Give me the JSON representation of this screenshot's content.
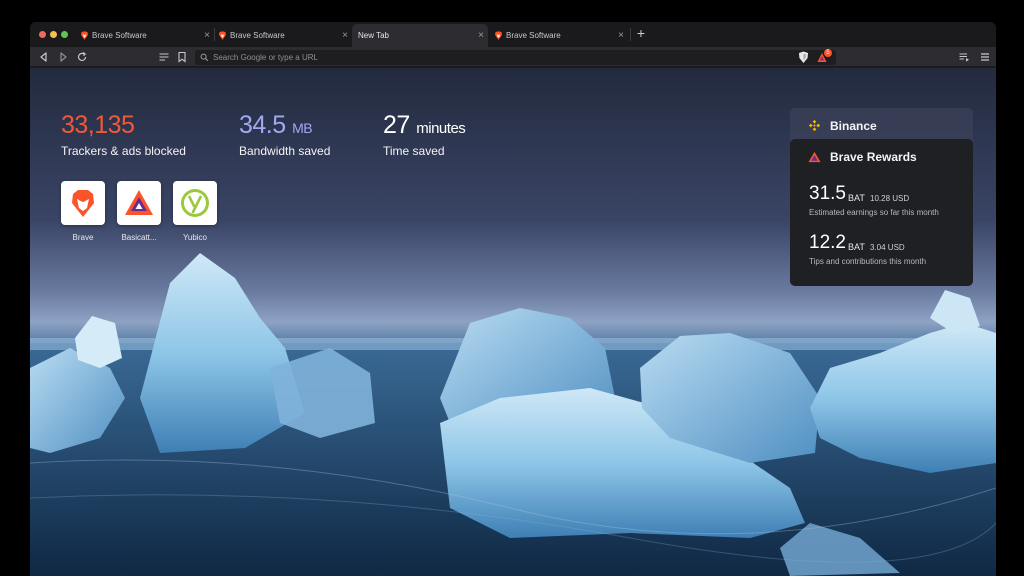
{
  "tabs": [
    {
      "title": "Brave Software",
      "icon": "brave-lion-icon",
      "active": false
    },
    {
      "title": "Brave Software",
      "icon": "brave-lion-icon",
      "active": false
    },
    {
      "title": "New Tab",
      "icon": "",
      "active": true
    },
    {
      "title": "Brave Software",
      "icon": "brave-lion-icon",
      "active": false
    }
  ],
  "tab_close_glyph": "×",
  "new_tab_glyph": "+",
  "toolbar": {
    "omnibox_placeholder": "Search Google or type a URL",
    "rewards_badge_count": "5"
  },
  "stats": {
    "trackers": {
      "value": "33,135",
      "label": "Trackers & ads blocked",
      "color": "#f0583a"
    },
    "bandwidth": {
      "value": "34.5",
      "unit": "MB",
      "label": "Bandwidth saved",
      "color": "#a4a7f2"
    },
    "time": {
      "value": "27",
      "unit": "minutes",
      "label": "Time saved",
      "color": "#ffffff"
    }
  },
  "top_sites": [
    {
      "name": "Brave",
      "icon": "brave-lion-icon"
    },
    {
      "name": "Basicatt...",
      "icon": "bat-triangle-icon"
    },
    {
      "name": "Yubico",
      "icon": "yubico-icon"
    }
  ],
  "binance": {
    "title": "Binance",
    "icon": "binance-icon",
    "color": "#f0b90b"
  },
  "rewards": {
    "title": "Brave Rewards",
    "icon": "bat-triangle-icon",
    "earnings": {
      "amount": "31.5",
      "unit": "BAT",
      "usd": "10.28 USD",
      "caption": "Estimated earnings so far this month"
    },
    "tips": {
      "amount": "12.2",
      "unit": "BAT",
      "usd": "3.04 USD",
      "caption": "Tips and contributions this month"
    }
  }
}
